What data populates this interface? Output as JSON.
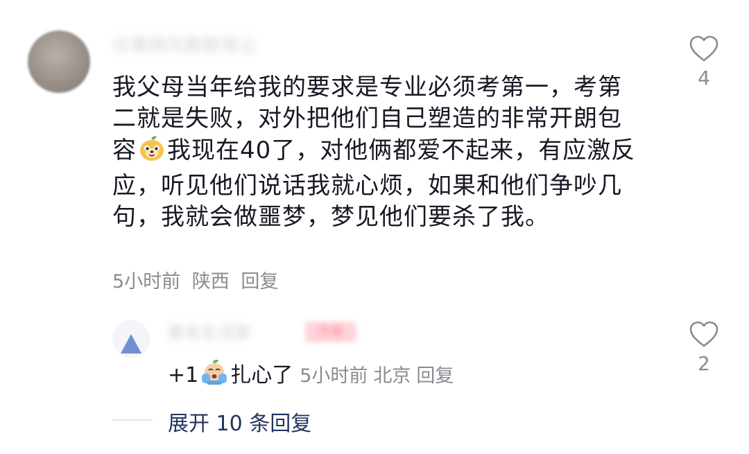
{
  "comment1": {
    "lines": [
      "我父母当年给我的要求是专业必须考第一，考第",
      "二就是失败，对外把他们自己塑造的非常开朗包",
      "我现在40了，对他俩都爱不起来，有应激反",
      "应，听见他们说话我就心烦，如果和他们争吵几",
      "句，我就会做噩梦，梦见他们要杀了我。"
    ],
    "line3_prefix": "容",
    "emoji": "dog-face-emoji",
    "time": "5小时前",
    "location": "陕西",
    "reply_label": "回复",
    "like_count": "4"
  },
  "reply1": {
    "text_prefix": "+1",
    "emoji": "crying-face-emoji",
    "text_suffix": "扎心了",
    "time": "5小时前",
    "location": "北京",
    "reply_label": "回复",
    "like_count": "2"
  },
  "expand_label": "展开 10 条回复",
  "colors": {
    "text": "#161823",
    "meta": "#8a8b91",
    "expand": "#24345e"
  }
}
